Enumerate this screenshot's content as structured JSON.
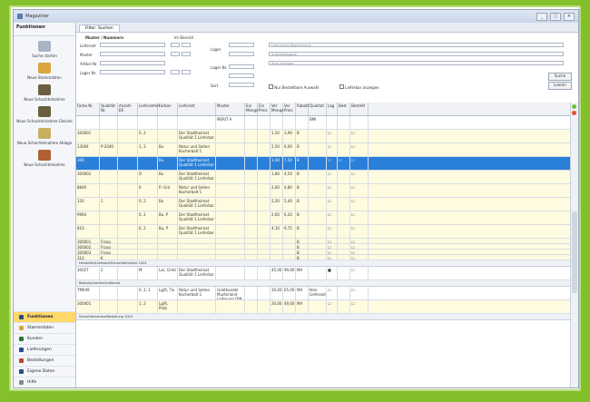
{
  "window": {
    "title": "Magaziner",
    "controls": [
      "_",
      "□",
      "×"
    ]
  },
  "sidebar": {
    "title": "Funktionen",
    "items": [
      {
        "label": "Suche starten",
        "icon": "arrow-icon",
        "color": "#a8b4c4"
      },
      {
        "label": "Neue Stammdaten",
        "icon": "document-icon",
        "color": "#d9a640"
      },
      {
        "label": "Neue Schachtelnahme",
        "icon": "package-icon",
        "color": "#6a6040"
      },
      {
        "label": "Neue Schachtelnahme Gleiche",
        "icon": "package-icon",
        "color": "#6a6040"
      },
      {
        "label": "Neue Schachtelnahme Ablage",
        "icon": "box-icon",
        "color": "#c8b060"
      },
      {
        "label": "Neue Schachtelnahme",
        "icon": "crate-icon",
        "color": "#b06030"
      }
    ],
    "nav": [
      {
        "label": "Funktionen",
        "icon_color": "#2b4a8c",
        "selected": true
      },
      {
        "label": "Stammdaten",
        "icon_color": "#d9a640",
        "selected": false
      },
      {
        "label": "Kunden",
        "icon_color": "#2b7a3a",
        "selected": false
      },
      {
        "label": "Lieferungen",
        "icon_color": "#2b4a8c",
        "selected": false
      },
      {
        "label": "Bestellungen",
        "icon_color": "#c04030",
        "selected": false
      },
      {
        "label": "Eigene Daten",
        "icon_color": "#2b4a8c",
        "selected": false
      },
      {
        "label": "Hilfe",
        "icon_color": "#888888",
        "selected": false
      }
    ]
  },
  "tab": {
    "label": "Filter: Suchen"
  },
  "filters": {
    "group_label": "Muster / Nummern",
    "right_label": "Im Bereich",
    "rows": [
      {
        "label": "Lieferant"
      },
      {
        "label": "Muster"
      },
      {
        "label": "Artikel Nr."
      },
      {
        "label": "Lager Nr."
      }
    ],
    "mid_labels": [
      "Lager",
      "Lager Nr.",
      "Sort"
    ],
    "right_placeholders": [
      "Lieferanten Bezeichnung",
      "Artikelkategorie",
      "Alles anzeigen"
    ],
    "checkbox1": "Nur Bestellbare Auswahl",
    "checkbox2": "Lieferbar anzeigen",
    "btn_search": "Suche",
    "btn_reset": "Leeren"
  },
  "table": {
    "headers": [
      "Farbe Nr.",
      "Qualität Nr.",
      "Anzahl EK",
      "Lieferanten",
      "Farben",
      "Lieferant",
      "Muster",
      "Ein Menge",
      "Ein Preis",
      "Ver Menge",
      "Ver Preis",
      "Rabatt",
      "Qualitat",
      "Lag",
      "Best",
      "Bestellt"
    ],
    "rows": [
      {
        "cells": [
          "",
          "",
          "",
          "",
          "",
          "",
          "MERIT A",
          "",
          "",
          "",
          "",
          "",
          "BMI",
          "",
          "",
          ""
        ],
        "style": "white"
      },
      {
        "cells": [
          "300001",
          "",
          "",
          "0, 2",
          "",
          "Der Stadtheimat Qualität 1 Lieferbar",
          "",
          "",
          "",
          "1,50",
          "3,90",
          "B",
          "",
          "☐",
          "",
          "☐"
        ],
        "style": "yellow"
      },
      {
        "cells": [
          "13004",
          "P-2040",
          "",
          "1, 2",
          "Bu",
          "Natur und Seiten Kocherbalt 1",
          "",
          "",
          "",
          "2,50",
          "6,00",
          "B",
          "",
          "☐",
          "",
          "☐"
        ],
        "style": "yellow"
      },
      {
        "cells": [
          "300",
          "",
          "",
          "",
          "Bu",
          "Der Stadtheimat Qualität 1 Lieferbar",
          "",
          "",
          "",
          "3,00",
          "7,50",
          "B",
          "",
          "☐",
          "☐",
          "☐"
        ],
        "style": "sel"
      },
      {
        "cells": [
          "300002",
          "",
          "",
          "D",
          "Bu",
          "Der Stadtheimat Qualität 1 Lieferbar",
          "",
          "",
          "",
          "1,80",
          "4,50",
          "B",
          "",
          "☐",
          "",
          "☐"
        ],
        "style": "yellow"
      },
      {
        "cells": [
          "8840",
          "",
          "",
          "6",
          "P, Grd",
          "Natur und Seiten Kocherbalt 1",
          "",
          "",
          "",
          "2,00",
          "4,80",
          "B",
          "",
          "☐",
          "",
          "☐"
        ],
        "style": "yellow"
      },
      {
        "cells": [
          "120",
          "1",
          "",
          "0, 2",
          "Bu",
          "Der Stadtheimat Qualität 1 Lieferbar",
          "",
          "",
          "",
          "2,20",
          "5,40",
          "B",
          "",
          "☐",
          "",
          "☐"
        ],
        "style": "yellow"
      },
      {
        "cells": [
          "9964",
          "",
          "",
          "0, 2",
          "Bu, P",
          "Der Stadtheimat Qualität 1 Lieferbar",
          "",
          "",
          "",
          "2,60",
          "6,20",
          "B",
          "",
          "☐",
          "",
          "☐"
        ],
        "style": "yellow"
      },
      {
        "cells": [
          "810",
          "",
          "",
          "6, 2",
          "Bu, P",
          "Der Stadtheimat Qualität 1 Lieferbar",
          "",
          "",
          "",
          "4,10",
          "9,75",
          "B",
          "",
          "☐",
          "",
          "☐"
        ],
        "style": "yellow"
      },
      {
        "cells": [
          "300001",
          "Frzug",
          "",
          "",
          "",
          "",
          "",
          "",
          "",
          "",
          "",
          "B",
          "",
          "☐",
          "",
          "☐"
        ],
        "style": "short"
      },
      {
        "cells": [
          "300002",
          "Frzug",
          "",
          "",
          "",
          "",
          "",
          "",
          "",
          "",
          "",
          "B",
          "",
          "☐",
          "",
          "☐"
        ],
        "style": "short"
      },
      {
        "cells": [
          "300003",
          "Frzug",
          "",
          "",
          "",
          "",
          "",
          "",
          "",
          "",
          "",
          "B",
          "",
          "☐",
          "",
          "☐"
        ],
        "style": "short"
      },
      {
        "cells": [
          "310",
          "K",
          "",
          "",
          "",
          "",
          "",
          "",
          "",
          "",
          "",
          "B",
          "",
          "☐",
          "",
          "☐"
        ],
        "style": "short"
      }
    ],
    "group1": "Hersteller/Lieferant/Schachtelnahme 1024",
    "group1_rows": [
      {
        "cells": [
          "3002T",
          "2",
          "",
          "M",
          "Lar, Grdd",
          "Der Stadtheimat Qualität 1 Lieferbar",
          "",
          "",
          "",
          "45,00",
          "99,00",
          "MA",
          "",
          "■",
          "",
          "☐"
        ],
        "style": "white"
      }
    ],
    "group2": "Bestellschachtel/Lieferant",
    "group2_rows": [
      {
        "cells": [
          "TM049",
          "",
          "",
          "0, 2, 1",
          "Lg/R, Tie",
          "Natur und Seiten Kocherbalt 1",
          "Großhandel Musterland Lieferung DIN",
          "",
          "",
          "30,00",
          "65,00",
          "MA",
          "Kein Lieferant",
          "☐",
          "",
          "☐"
        ],
        "style": "white"
      },
      {
        "cells": [
          "300001",
          "",
          "",
          "1, 2",
          "Lg/R, Prob",
          "",
          "",
          "",
          "",
          "20,00",
          "49,00",
          "MA",
          "",
          "☐",
          "",
          "☐"
        ],
        "style": "yellow"
      }
    ],
    "group3": "Schachtelnahme/Bestellung 1024"
  },
  "colors": {
    "selected_row": "#2a7fd8",
    "yellow_row": "#fffbe0",
    "border": "#84bf2c"
  }
}
